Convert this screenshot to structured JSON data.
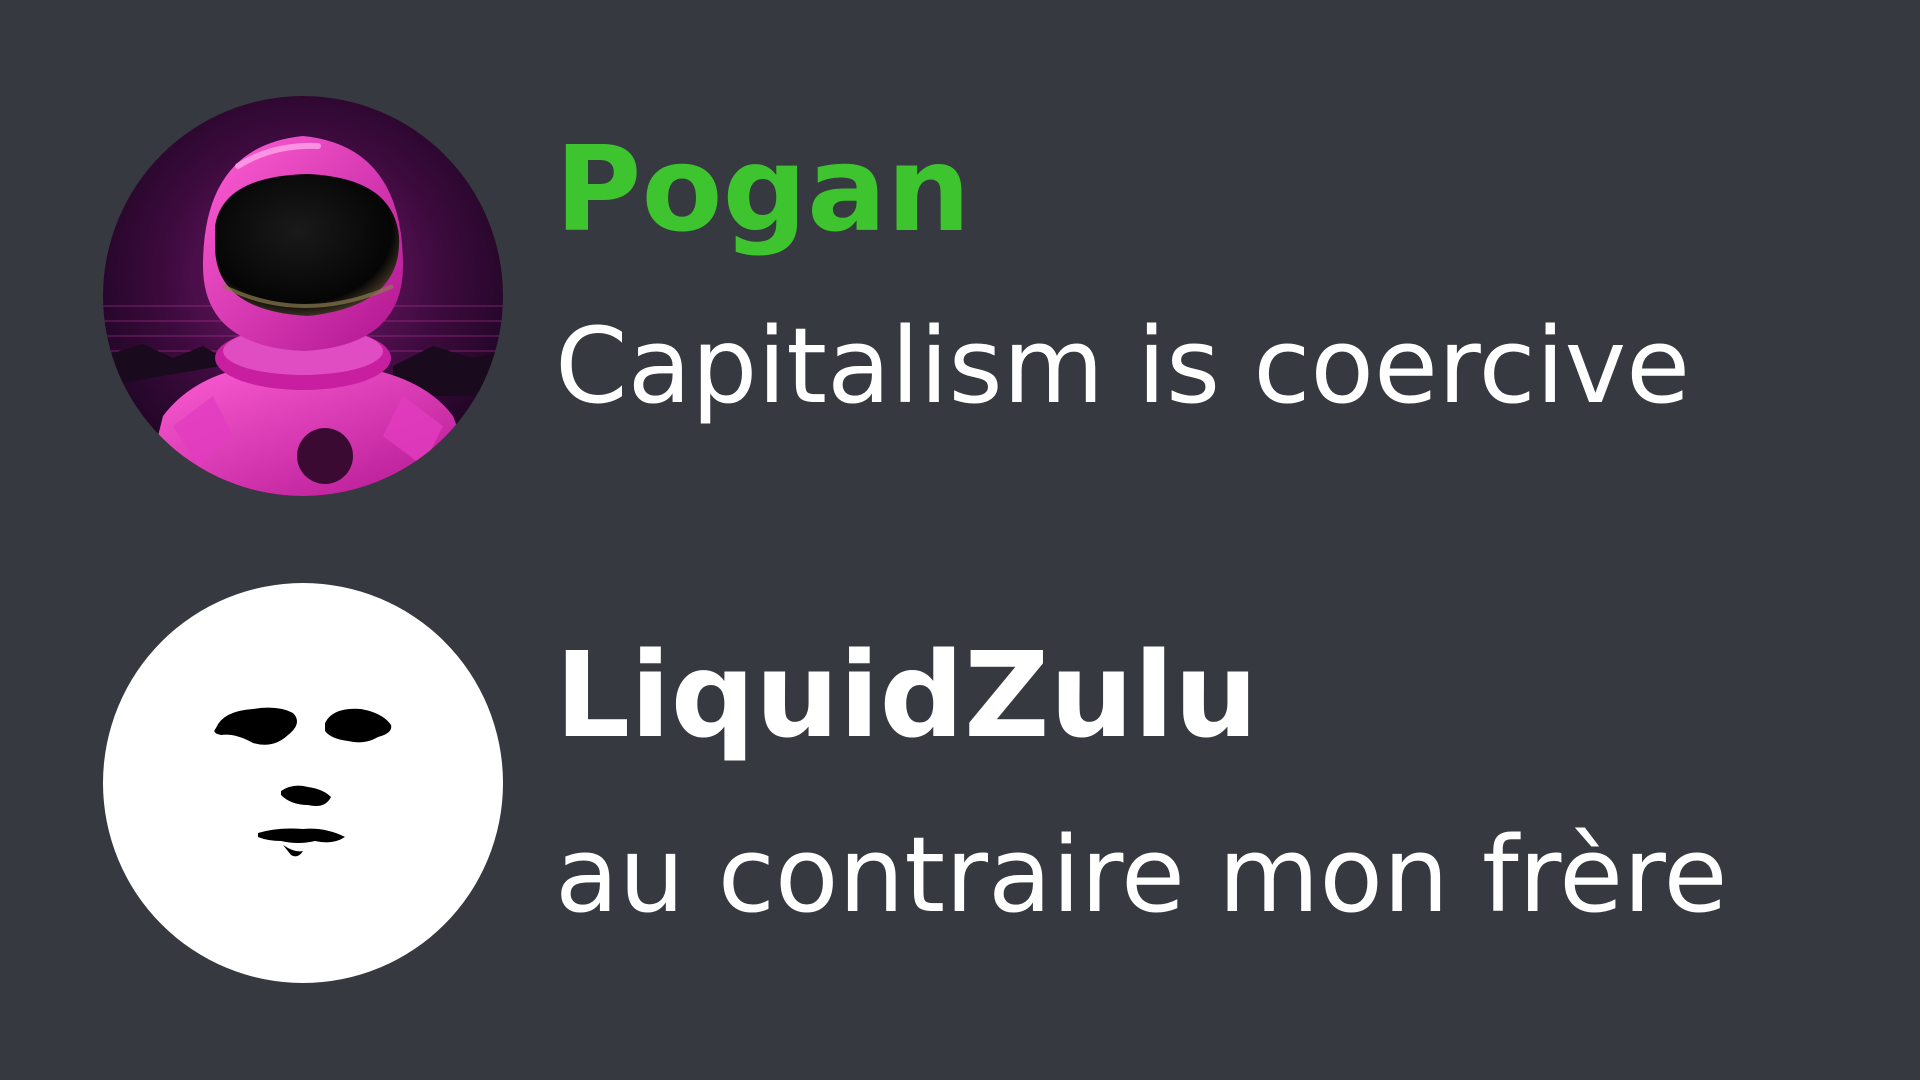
{
  "colors": {
    "background": "#36393f",
    "pogan_name": "#3ec42f",
    "liquidzulu_name": "#ffffff",
    "message_text": "#ffffff"
  },
  "messages": [
    {
      "username": "Pogan",
      "text": "Capitalism is coercive",
      "avatar_icon": "pink-astronaut-avatar"
    },
    {
      "username": "LiquidZulu",
      "text": "au contraire mon frère",
      "avatar_icon": "white-face-avatar"
    }
  ]
}
